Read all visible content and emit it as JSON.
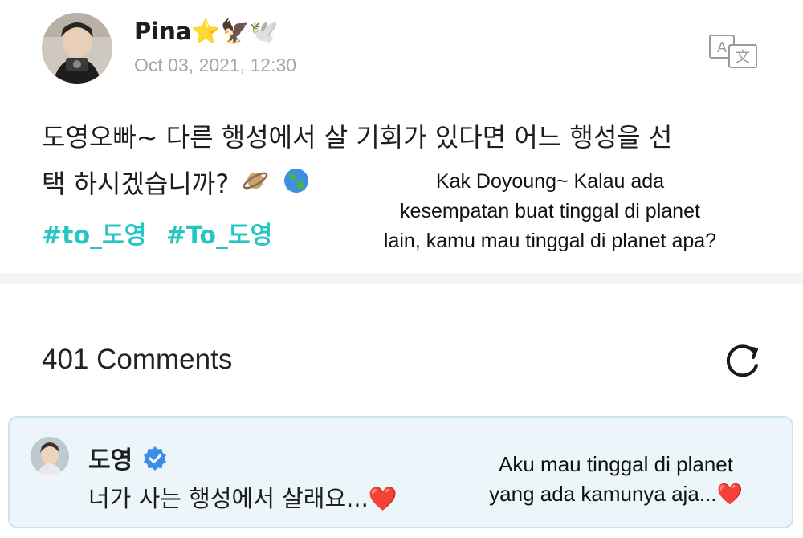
{
  "post": {
    "author": "Pina⭐🦅🕊️",
    "timestamp": "Oct 03, 2021, 12:30",
    "text_line1": "도영오빠~ 다른 행성에서 살 기회가 있다면 어느 행성을 선",
    "text_line2": "택 하시겠습니까?",
    "emojis": [
      "planet-icon",
      "globe-icon"
    ],
    "hashtags": [
      "#to_도영",
      "#To_도영"
    ],
    "translation_line1": "Kak Doyoung~ Kalau ada",
    "translation_line2": "kesempatan buat tinggal di planet",
    "translation_line3": "lain, kamu mau tinggal di planet apa?"
  },
  "comments": {
    "header": "401 Comments",
    "refresh_icon": "refresh-icon",
    "items": [
      {
        "author": "도영",
        "verified": true,
        "text": "너가 사는 행성에서 살래요...",
        "heart": "❤️",
        "translation_line1": "Aku mau tinggal di planet",
        "translation_line2": "yang ada kamunya aja...",
        "translation_heart": "❤️"
      }
    ]
  },
  "colors": {
    "hashtag": "#27c5c3",
    "timestamp": "#a6a6a6",
    "comment_bg": "#ecf5fa",
    "verified": "#3b8fe8"
  }
}
